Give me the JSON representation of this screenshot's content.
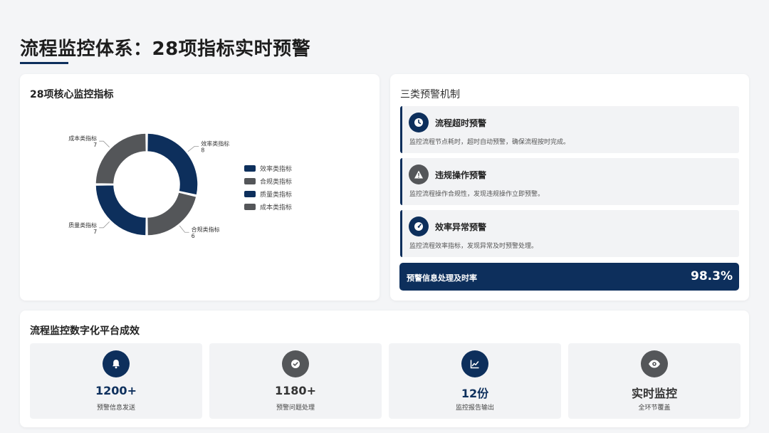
{
  "page": {
    "title": "流程监控体系：28项指标实时预警"
  },
  "colors": {
    "navy": "#0d2f5c",
    "gray": "#545659"
  },
  "indicator_panel": {
    "title": "28项核心监控指标",
    "legend": [
      "效率类指标",
      "合规类指标",
      "质量类指标",
      "成本类指标"
    ]
  },
  "chart_data": {
    "type": "pie",
    "style": "donut",
    "categories": [
      "效率类指标",
      "合规类指标",
      "质量类指标",
      "成本类指标"
    ],
    "values": [
      8,
      6,
      7,
      7
    ],
    "colors": [
      "#0d2f5c",
      "#545659",
      "#0d2f5c",
      "#545659"
    ],
    "legend_position": "right",
    "data_labels": [
      {
        "name": "效率类指标",
        "value": "8"
      },
      {
        "name": "合规类指标",
        "value": "6"
      },
      {
        "name": "质量类指标",
        "value": "7"
      },
      {
        "name": "成本类指标",
        "value": "7"
      }
    ]
  },
  "alert_panel": {
    "title": "三类预警机制",
    "alerts": [
      {
        "icon": "clock-icon",
        "title": "流程超时预警",
        "desc": "监控流程节点耗时，超时自动预警，确保流程按时完成。"
      },
      {
        "icon": "warning-icon",
        "title": "违规操作预警",
        "desc": "监控流程操作合规性，发现违规操作立即预警。"
      },
      {
        "icon": "speedometer-icon",
        "title": "效率异常预警",
        "desc": "监控流程效率指标，发现异常及时预警处理。"
      }
    ],
    "rate_label": "预警信息处理及时率",
    "rate_value": "98.3%"
  },
  "results_panel": {
    "title": "流程监控数字化平台成效",
    "stats": [
      {
        "icon": "bell-icon",
        "value": "1200+",
        "label": "预警信息发送"
      },
      {
        "icon": "check-circle-icon",
        "value": "1180+",
        "label": "预警问题处理"
      },
      {
        "icon": "chart-line-icon",
        "value": "12份",
        "label": "监控报告输出"
      },
      {
        "icon": "eye-icon",
        "value": "实时监控",
        "label": "全环节覆盖"
      }
    ]
  }
}
